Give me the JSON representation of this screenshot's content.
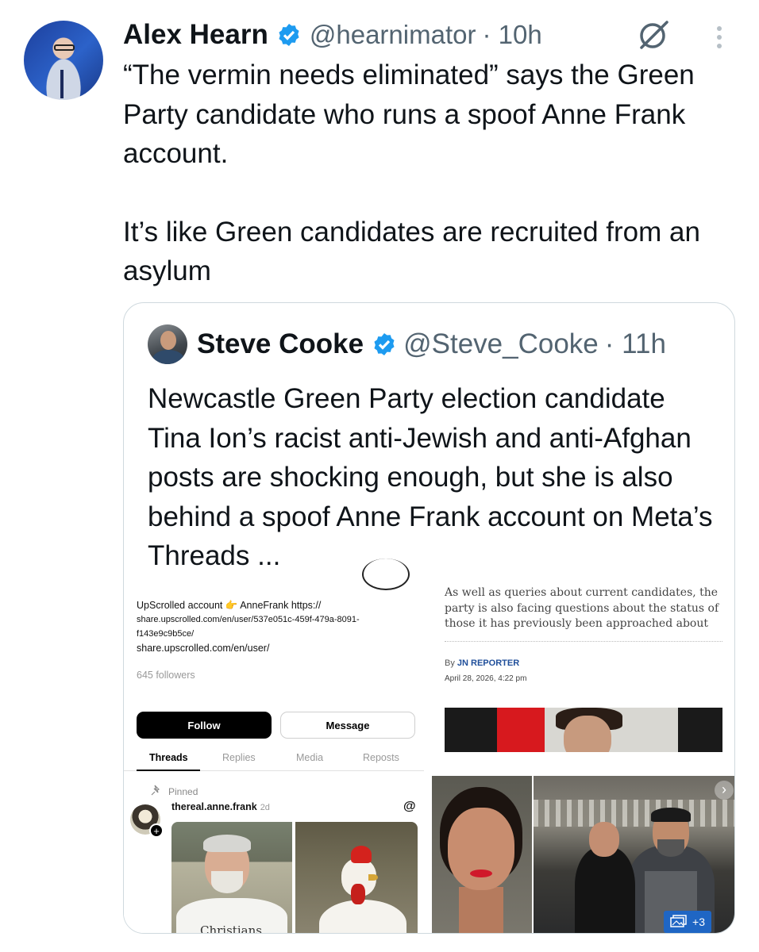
{
  "tweet": {
    "author_name": "Alex Hearn",
    "handle": "@hearnimator",
    "time": "· 10h",
    "text_line1": "“The vermin needs eliminated” says the Green Party candidate who runs a spoof Anne Frank account.",
    "text_line2": "It’s like Green candidates are recruited from an asylum"
  },
  "quote": {
    "author_name": "Steve Cooke",
    "handle": "@Steve_Cooke",
    "time": "· 11h",
    "text": "Newcastle Green Party election candidate Tina Ion’s racist anti-Jewish and anti-Afghan posts are shocking enough, but she is also behind a spoof Anne Frank account on Meta’s Threads ..."
  },
  "threads_profile": {
    "bio_line1": "UpScrolled account 👉 AnneFrank https://",
    "bio_line2": "share.upscrolled.com/en/user/537e051c-459f-479a-8091-",
    "bio_line3": "f143e9c9b5ce/",
    "bio_line4": "share.upscrolled.com/en/user/",
    "followers": "645 followers",
    "follow_label": "Follow",
    "message_label": "Message",
    "tabs": [
      "Threads",
      "Replies",
      "Media",
      "Reposts"
    ],
    "pinned_label": "Pinned",
    "post_user": "thereal.anne.frank",
    "post_time": "2d",
    "shirt_text": "Christians"
  },
  "article": {
    "text": "As well as queries about current candidates, the party is also facing questions about the status of those it has previously been approached about",
    "by_prefix": "By",
    "reporter": "JN REPORTER",
    "date": "April 28, 2026, 4:22 pm"
  },
  "gallery": {
    "more_count": "+3"
  },
  "colors": {
    "verified": "#1d9bf0",
    "secondary_text": "#536471",
    "badge": "#1f66c4"
  },
  "icons": [
    "verified-badge-icon",
    "grok-icon",
    "more-options-icon",
    "pin-icon",
    "threads-logo-icon",
    "next-chevron-icon",
    "gallery-icon"
  ]
}
